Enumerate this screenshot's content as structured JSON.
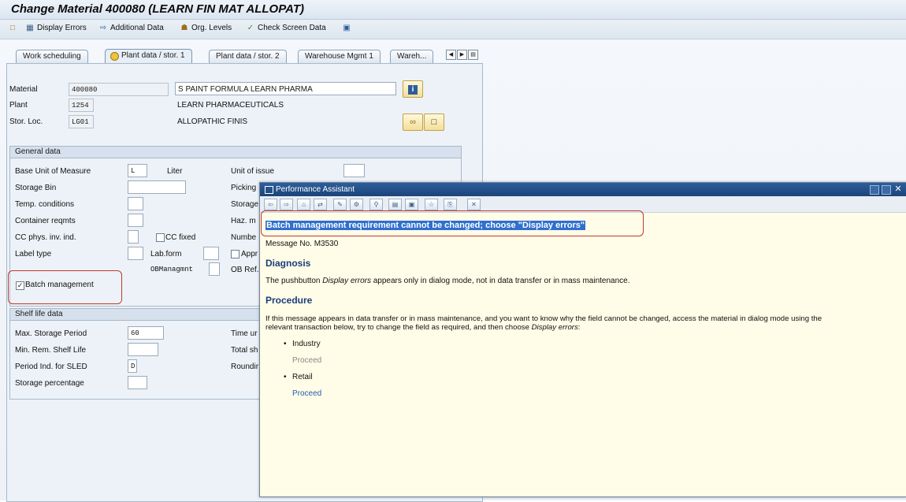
{
  "window": {
    "title": "Change Material 400080 (LEARN FIN MAT ALLOPAT)"
  },
  "toolbar": {
    "display_errors": "Display Errors",
    "additional_data": "Additional Data",
    "org_levels": "Org. Levels",
    "check_screen_data": "Check Screen Data"
  },
  "tabs": [
    {
      "label": "Work scheduling"
    },
    {
      "label": "Plant data / stor. 1"
    },
    {
      "label": "Plant data / stor. 2"
    },
    {
      "label": "Warehouse Mgmt 1"
    },
    {
      "label": "Wareh..."
    }
  ],
  "header": {
    "material_label": "Material",
    "material_value": "400080",
    "material_desc": "S PAINT FORMULA LEARN PHARMA",
    "plant_label": "Plant",
    "plant_value": "1254",
    "plant_desc": "LEARN PHARMACEUTICALS",
    "stor_loc_label": "Stor. Loc.",
    "stor_loc_value": "LG01",
    "stor_loc_desc": "ALLOPATHIC FINIS"
  },
  "general": {
    "title": "General data",
    "base_uom_label": "Base Unit of Measure",
    "base_uom_value": "L",
    "base_uom_text": "Liter",
    "unit_issue_label": "Unit of issue",
    "storage_bin_label": "Storage Bin",
    "picking_label": "Picking",
    "temp_label": "Temp. conditions",
    "storage_label": "Storage",
    "container_label": "Container reqmts",
    "haz_label": "Haz. m",
    "cc_phys_label": "CC phys. inv. ind.",
    "cc_fixed_label": "CC fixed",
    "number_label": "Numbe",
    "label_type_label": "Label type",
    "lab_form_label": "Lab.form",
    "appr_label": "Appr",
    "ob_managmnt_label": "OBManagmnt",
    "ob_ref_label": "OB Ref.",
    "batch_label": "Batch management",
    "batch_checked": true
  },
  "shelf": {
    "title": "Shelf life data",
    "max_storage_label": "Max. Storage Period",
    "max_storage_value": "60",
    "time_label": "Time ur",
    "min_rem_label": "Min. Rem. Shelf Life",
    "total_label": "Total sh",
    "period_sled_label": "Period Ind. for SLED",
    "period_sled_value": "D",
    "rounding_label": "Roundir",
    "storage_pct_label": "Storage percentage"
  },
  "assistant": {
    "title": "Performance Assistant",
    "message": "Batch management requirement cannot be changed; choose \"Display errors\"",
    "message_no": "Message No. M3530",
    "diagnosis_heading": "Diagnosis",
    "diagnosis_before": "The pushbutton ",
    "diagnosis_em": "Display errors",
    "diagnosis_after": " appears only in dialog mode, not in data transfer or in mass maintenance.",
    "procedure_heading": "Procedure",
    "procedure_line1": "If this message appears in data transfer or in mass maintenance, and you want to know why the field cannot be changed, access the material in dialog mode using the",
    "procedure_line2_before": "relevant transaction below, try to change the field as required, and then choose ",
    "procedure_line2_em": "Display errors",
    "procedure_line2_after": ":",
    "industry_label": "Industry",
    "industry_proceed": "Proceed",
    "retail_label": "Retail",
    "retail_proceed": "Proceed"
  },
  "colors": {
    "highlight": "#2f6fd0",
    "link": "#1f5fb0",
    "disabled_link": "#8a8a8a",
    "annotation": "#c0392b"
  }
}
